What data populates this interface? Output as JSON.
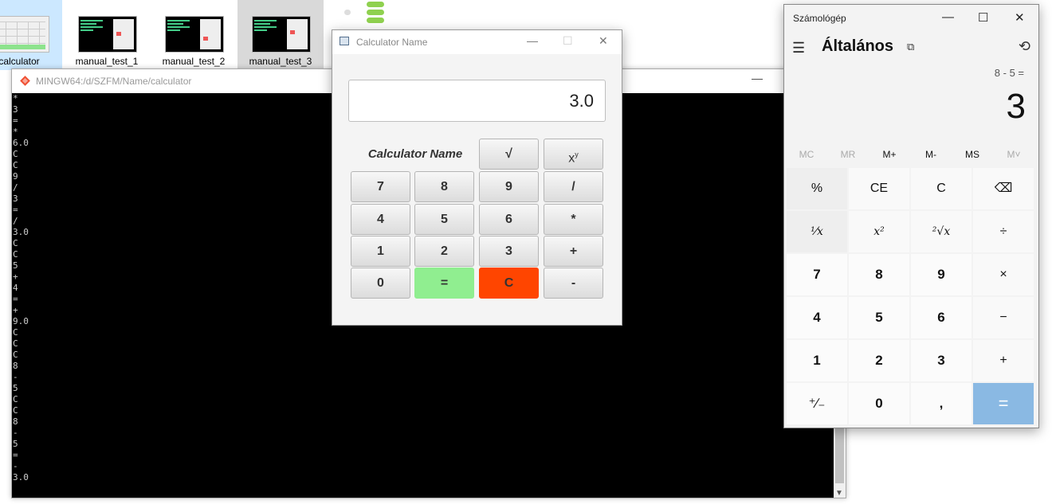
{
  "explorer": {
    "items": [
      {
        "label": "calculator"
      },
      {
        "label": "manual_test_1"
      },
      {
        "label": "manual_test_2"
      },
      {
        "label": "manual_test_3"
      }
    ]
  },
  "terminal": {
    "title": "MINGW64:/d/SZFM/Name/calculator",
    "minimize_glyph": "—",
    "lines": [
      "*",
      "3",
      "=",
      "*",
      "6.0",
      "C",
      "C",
      "9",
      "/",
      "3",
      "=",
      "/",
      "3.0",
      "C",
      "C",
      "5",
      "+",
      "4",
      "=",
      "+",
      "9.0",
      "C",
      "C",
      "C",
      "8",
      "-",
      "5",
      "C",
      "C",
      "8",
      "-",
      "5",
      "=",
      "-",
      "3.0"
    ]
  },
  "javafx_calc": {
    "title": "Calculator Name",
    "display": "3.0",
    "label": "Calculator Name",
    "buttons": {
      "sqrt": "√",
      "pow": "x",
      "pow_sup": "y",
      "seven": "7",
      "eight": "8",
      "nine": "9",
      "div": "/",
      "four": "4",
      "five": "5",
      "six": "6",
      "mul": "*",
      "one": "1",
      "two": "2",
      "three": "3",
      "add": "+",
      "zero": "0",
      "equals": "=",
      "clear": "C",
      "sub": "-"
    },
    "colors": {
      "equals": "#90ee90",
      "clear": "#ff4500"
    }
  },
  "windows_calc": {
    "title": "Számológép",
    "mode": "Általános",
    "expression": "8 - 5 =",
    "result": "3",
    "memory": [
      "MC",
      "MR",
      "M+",
      "M-",
      "MS",
      "M˅"
    ],
    "keys": {
      "percent": "%",
      "ce": "CE",
      "c": "C",
      "backspace": "⌫",
      "reciprocal": "¹⁄x",
      "square": "x²",
      "sqrt": "²√x",
      "divide": "÷",
      "seven": "7",
      "eight": "8",
      "nine": "9",
      "multiply": "×",
      "four": "4",
      "five": "5",
      "six": "6",
      "minus": "−",
      "one": "1",
      "two": "2",
      "three": "3",
      "plus": "+",
      "negate": "⁺∕₋",
      "zero": "0",
      "decimal": ",",
      "equals": "="
    },
    "colors": {
      "equals": "#8ab9e3"
    }
  }
}
